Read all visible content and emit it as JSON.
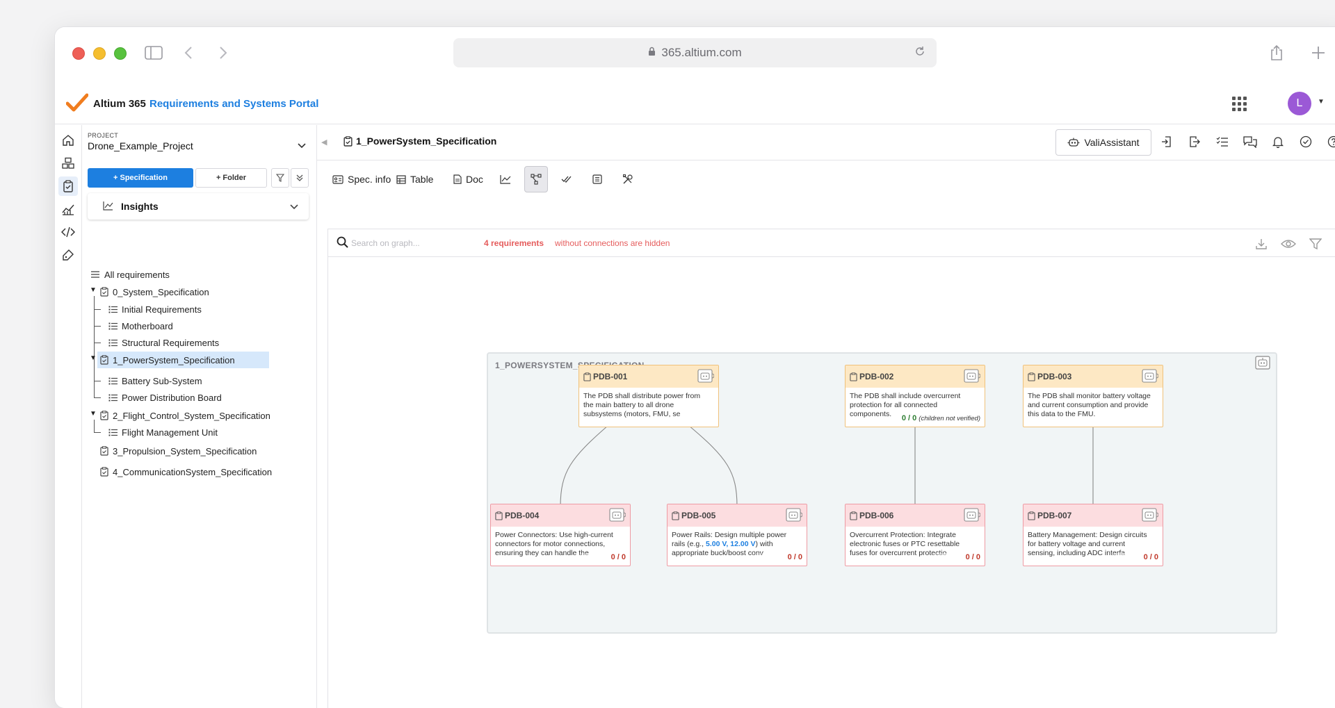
{
  "browser": {
    "url": "365.altium.com"
  },
  "app": {
    "brand": "Altium 365",
    "product": "Requirements and Systems Portal",
    "user_initial": "L"
  },
  "sidebar": {
    "project_label": "PROJECT",
    "project_name": "Drone_Example_Project",
    "spec_button": "+ Specification",
    "folder_button": "+ Folder",
    "insights_label": "Insights",
    "all_requirements": "All requirements",
    "tree": [
      {
        "label": "0_System_Specification"
      },
      {
        "label": "Initial Requirements"
      },
      {
        "label": "Motherboard"
      },
      {
        "label": "Structural Requirements"
      },
      {
        "label": "1_PowerSystem_Specification"
      },
      {
        "label": "Battery Sub-System"
      },
      {
        "label": "Power Distribution Board"
      },
      {
        "label": "2_Flight_Control_System_Specification"
      },
      {
        "label": "Flight Management Unit"
      },
      {
        "label": "3_Propulsion_System_Specification"
      },
      {
        "label": "4_CommunicationSystem_Specification"
      }
    ]
  },
  "main": {
    "title": "1_PowerSystem_Specification",
    "vali_button": "ValiAssistant",
    "toolbar": {
      "spec_info": "Spec. info",
      "table": "Table",
      "doc": "Doc"
    },
    "graph": {
      "search_placeholder": "Search on graph...",
      "hidden_count": "4 requirements",
      "hidden_text": "without connections are hidden",
      "container_title": "1_POWERSYSTEM_SPECIFICATION",
      "nodes": [
        {
          "id": "PDB-001",
          "text": "The PDB shall distribute power from the main battery to all drone subsystems (motors, FMU, se"
        },
        {
          "id": "PDB-002",
          "text": "The PDB shall include overcurrent protection for all connected components.",
          "status": "0 / 0",
          "note": "(children not verified)"
        },
        {
          "id": "PDB-003",
          "text": "The PDB shall monitor battery voltage and current consumption and provide this data to the FMU."
        },
        {
          "id": "PDB-004",
          "text": "Power Connectors: Use high-current connectors for motor connections, ensuring they can handle the",
          "status": "0 / 0"
        },
        {
          "id": "PDB-005",
          "text_a": "Power Rails: Design multiple power rails (e.g., ",
          "v1": "5.00  V",
          "sep": ", ",
          "v2": "12.00  V",
          "text_b": ") with appropriate buck/boost conv",
          "status": "0 / 0"
        },
        {
          "id": "PDB-006",
          "text": "Overcurrent Protection: Integrate electronic fuses or PTC resettable fuses for overcurrent protectio",
          "status": "0 / 0"
        },
        {
          "id": "PDB-007",
          "text": "Battery Management: Design circuits for battery voltage and current sensing, including ADC interfa",
          "status": "0 / 0"
        }
      ]
    }
  },
  "colors": {
    "accent": "#1d7fe0",
    "parent_header": "#fde8c4",
    "child_header": "#fcdde0",
    "warning": "#e55c5c"
  }
}
